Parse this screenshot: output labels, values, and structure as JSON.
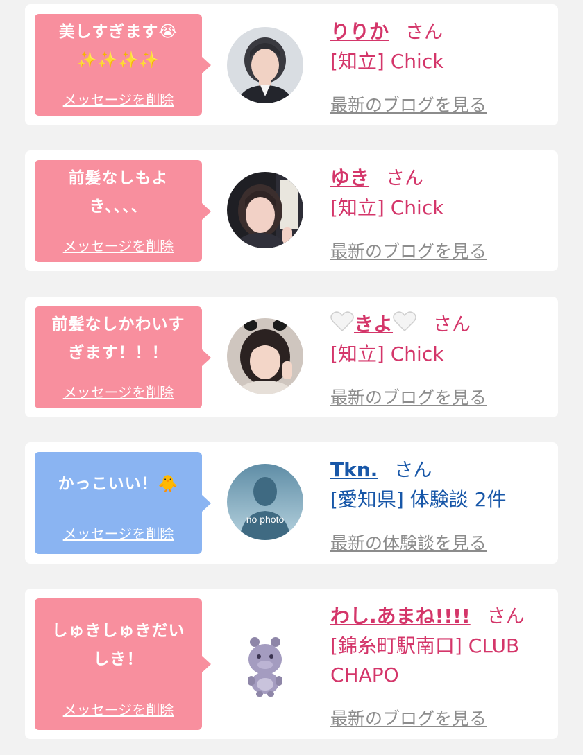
{
  "colors": {
    "bubble_pink": "#f88f9e",
    "bubble_blue": "#8ab4f2",
    "name_pink": "#d4366a",
    "name_blue": "#1857a8",
    "link_gray": "#8c8c8c",
    "background": "#f2f2f2"
  },
  "cards": [
    {
      "message_line1": "美しすぎます😭",
      "message_line2": "✨✨✨✨",
      "delete_label": "メッセージを削除",
      "name": "りりか",
      "honorific": "さん",
      "location": "[知立] Chick",
      "latest_link": "最新のブログを見る",
      "avatar_icon": "woman-photo"
    },
    {
      "message_line1": "前髪なしもよ",
      "message_line2": "き、、、、",
      "delete_label": "メッセージを削除",
      "name": "ゆき",
      "honorific": "さん",
      "location": "[知立] Chick",
      "latest_link": "最新のブログを見る",
      "avatar_icon": "woman-photo"
    },
    {
      "message_line1": "前髪なしかわいす",
      "message_line2": "ぎます！！！",
      "delete_label": "メッセージを削除",
      "name": "きよ",
      "honorific": "さん",
      "location": "[知立] Chick",
      "latest_link": "最新のブログを見る",
      "avatar_icon": "woman-photo"
    },
    {
      "message_line1": "かっこいい！🐥",
      "delete_label": "メッセージを削除",
      "name": "Tkn.",
      "honorific": "さん",
      "location": "[愛知県] 体験談 2件",
      "latest_link": "最新の体験談を見る",
      "avatar_icon": "no-photo-silhouette",
      "avatar_text": "no photo"
    },
    {
      "message_line1": "しゅきしゅきだい",
      "message_line2": "しき！",
      "delete_label": "メッセージを削除",
      "name": "わし.あまね!!!!",
      "honorific": "さん",
      "location_line1": "[錦糸町駅南口] CLUB",
      "location_line2": "CHAPO",
      "latest_link": "最新のブログを見る",
      "avatar_icon": "hippo-mascot-icon"
    }
  ]
}
